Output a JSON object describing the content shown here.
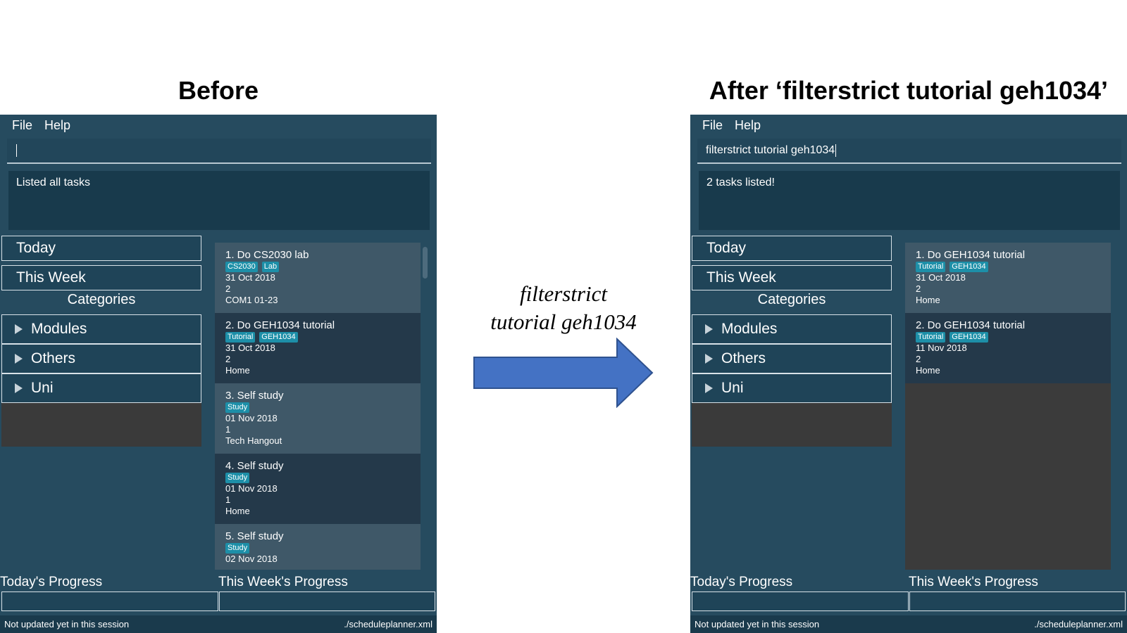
{
  "captions": {
    "before": "Before",
    "after": "After ‘filterstrict tutorial geh1034’"
  },
  "middle": {
    "line1": "filterstrict",
    "line2": "tutorial geh1034"
  },
  "colors": {
    "app_bg": "#264b5f",
    "result_bg": "#183a4c",
    "tag_bg": "#1d8fa8",
    "arrow_fill": "#4472c4"
  },
  "left_app": {
    "menu": {
      "file": "File",
      "help": "Help"
    },
    "command_value": "",
    "result_text": "Listed all tasks",
    "sidebar": {
      "today": "Today",
      "this_week": "This Week",
      "categories_title": "Categories",
      "tree": [
        "Modules",
        "Others",
        "Uni"
      ]
    },
    "tasks": [
      {
        "title": "1.  Do CS2030 lab",
        "tags": [
          "CS2030",
          "Lab"
        ],
        "date": "31 Oct 2018",
        "priority": "2",
        "venue": "COM1 01-23"
      },
      {
        "title": "2.  Do GEH1034 tutorial",
        "tags": [
          "Tutorial",
          "GEH1034"
        ],
        "date": "31 Oct 2018",
        "priority": "2",
        "venue": "Home"
      },
      {
        "title": "3.  Self study",
        "tags": [
          "Study"
        ],
        "date": "01 Nov 2018",
        "priority": "1",
        "venue": "Tech Hangout"
      },
      {
        "title": "4.  Self study",
        "tags": [
          "Study"
        ],
        "date": "01 Nov 2018",
        "priority": "1",
        "venue": "Home"
      },
      {
        "title": "5.  Self study",
        "tags": [
          "Study"
        ],
        "date": "02 Nov 2018",
        "priority": "",
        "venue": ""
      }
    ],
    "progress": {
      "today": "Today's Progress",
      "week": "This Week's Progress"
    },
    "status": {
      "sync": "Not updated yet in this session",
      "file": "./scheduleplanner.xml"
    }
  },
  "right_app": {
    "menu": {
      "file": "File",
      "help": "Help"
    },
    "command_value": "filterstrict tutorial geh1034",
    "result_text": "2 tasks listed!",
    "sidebar": {
      "today": "Today",
      "this_week": "This Week",
      "categories_title": "Categories",
      "tree": [
        "Modules",
        "Others",
        "Uni"
      ]
    },
    "tasks": [
      {
        "title": "1.  Do GEH1034 tutorial",
        "tags": [
          "Tutorial",
          "GEH1034"
        ],
        "date": "31 Oct 2018",
        "priority": "2",
        "venue": "Home"
      },
      {
        "title": "2.  Do GEH1034 tutorial",
        "tags": [
          "Tutorial",
          "GEH1034"
        ],
        "date": "11 Nov 2018",
        "priority": "2",
        "venue": "Home"
      }
    ],
    "progress": {
      "today": "Today's Progress",
      "week": "This Week's Progress"
    },
    "status": {
      "sync": "Not updated yet in this session",
      "file": "./scheduleplanner.xml"
    }
  }
}
